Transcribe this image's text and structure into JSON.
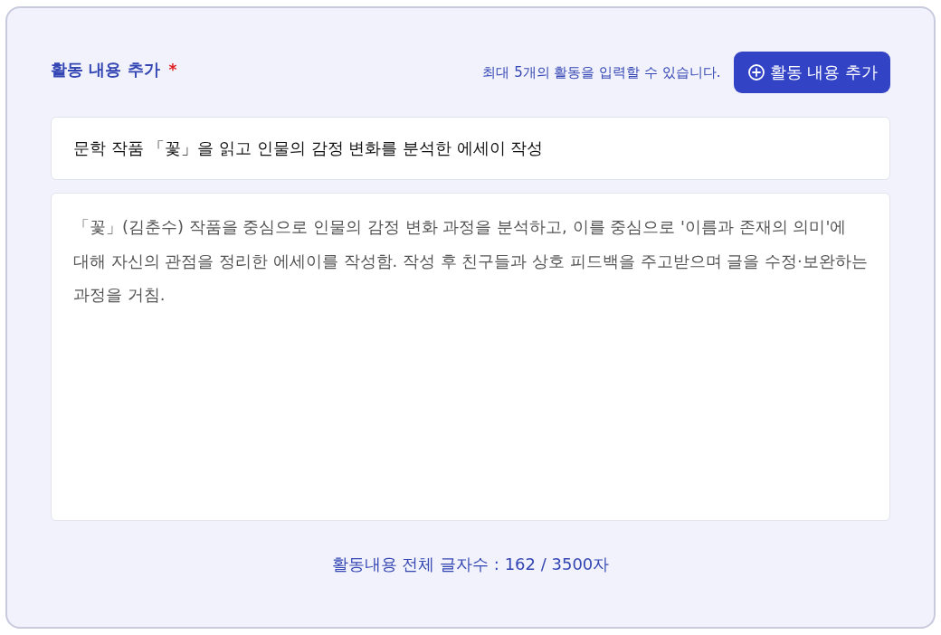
{
  "section": {
    "title": "활동 내용 추가",
    "required_mark": "*",
    "hint": "최대 5개의 활동을 입력할 수 있습니다.",
    "add_button": {
      "label": "활동 내용 추가"
    }
  },
  "activity": {
    "title": "문학 작품 「꽃」을 읽고 인물의 감정 변화를 분석한 에세이 작성",
    "description": "「꽃」(김춘수) 작품을 중심으로 인물의 감정 변화 과정을 분석하고, 이를 중심으로 '이름과 존재의 의미'에 대해 자신의 관점을 정리한 에세이를 작성함. 작성 후 친구들과 상호 피드백을 주고받으며 글을 수정·보완하는 과정을 거침."
  },
  "counter": "활동내용 전체 글자수 : 162 / 3500자"
}
